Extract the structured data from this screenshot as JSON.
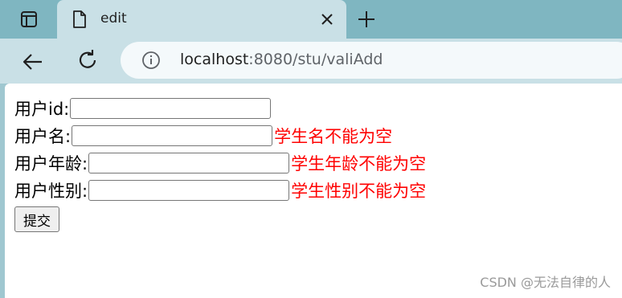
{
  "tab": {
    "title": "edit"
  },
  "address_bar": {
    "host": "localhost",
    "rest": ":8080/stu/valiAdd"
  },
  "form": {
    "fields": [
      {
        "label": "用户id:",
        "value": "",
        "error": ""
      },
      {
        "label": "用户名:",
        "value": "",
        "error": "学生名不能为空"
      },
      {
        "label": "用户年龄:",
        "value": "",
        "error": "学生年龄不能为空"
      },
      {
        "label": "用户性别:",
        "value": "",
        "error": "学生性别不能为空"
      }
    ],
    "submit_label": "提交"
  },
  "watermark": "CSDN @无法自律的人",
  "icons": {
    "tab_actions": "tab-actions-icon",
    "tab_page": "page-icon",
    "tab_close": "close-icon",
    "new_tab": "plus-icon",
    "back": "back-arrow-icon",
    "reload": "reload-icon",
    "site_info": "info-icon"
  },
  "colors": {
    "tabstrip": "#7fb6c1",
    "toolbar": "#c9e0e6",
    "error": "#ff0000",
    "watermark": "#9a9a9a"
  }
}
